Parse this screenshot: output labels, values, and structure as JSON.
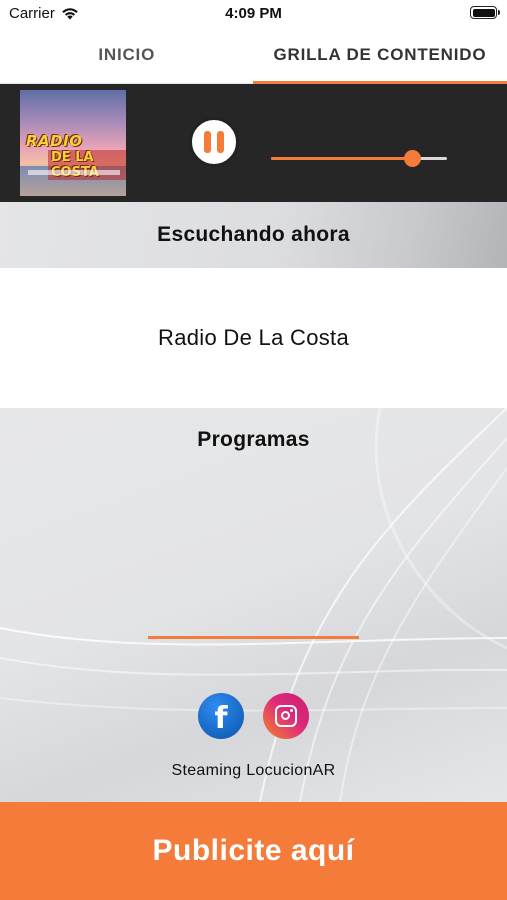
{
  "status_bar": {
    "carrier": "Carrier",
    "time": "4:09 PM"
  },
  "tabs": [
    {
      "label": "INICIO",
      "active": false
    },
    {
      "label": "GRILLA DE CONTENIDO",
      "active": true
    }
  ],
  "player": {
    "album_art_text": [
      "RADIO",
      "DE LA COSTA"
    ],
    "state": "playing",
    "volume": 0.8
  },
  "now_playing": {
    "heading": "Escuchando ahora",
    "station": "Radio De La Costa"
  },
  "programs": {
    "heading": "Programas"
  },
  "footer": {
    "credit": "Steaming LocucionAR"
  },
  "ad_banner": {
    "label": "Publicite aquí"
  },
  "colors": {
    "accent": "#f47b3a",
    "player_background": "#262626",
    "facebook": "#1565c0"
  },
  "icons": [
    "wifi-icon",
    "battery-icon",
    "pause-icon",
    "facebook-icon",
    "instagram-icon"
  ]
}
